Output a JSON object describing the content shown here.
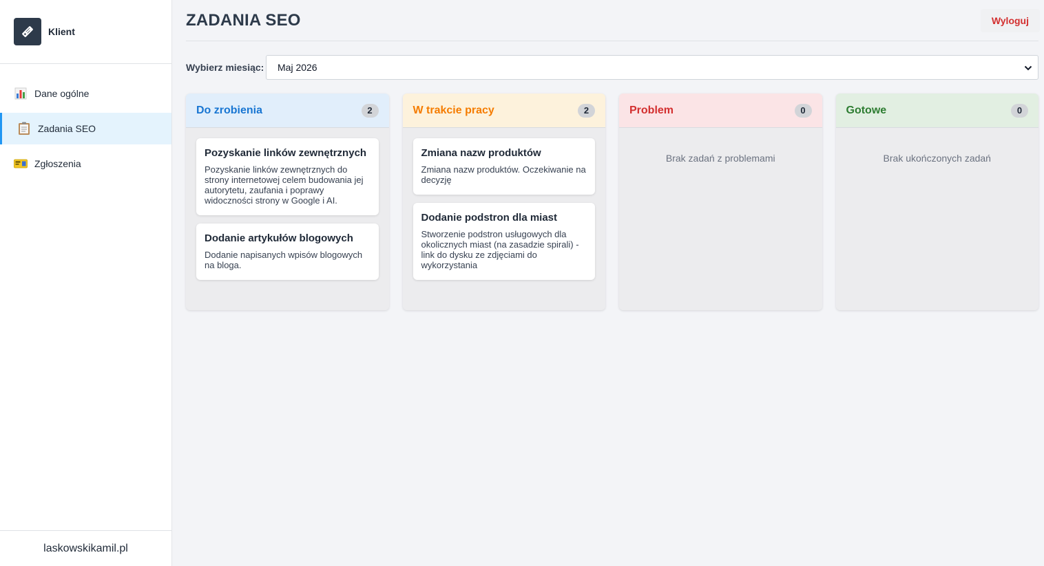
{
  "sidebar": {
    "brand_name": "Klient",
    "items": [
      {
        "label": "Dane ogólne",
        "icon": "bar-chart-icon"
      },
      {
        "label": "Zadania SEO",
        "icon": "clipboard-icon",
        "active": true
      },
      {
        "label": "Zgłoszenia",
        "icon": "ticket-icon"
      }
    ],
    "footer": "laskowskikamil.pl"
  },
  "header": {
    "title": "ZADANIA SEO",
    "logout_label": "Wyloguj"
  },
  "month": {
    "label": "Wybierz miesiąc:",
    "selected": "Maj 2026"
  },
  "columns": [
    {
      "title": "Do zrobienia",
      "count": "2",
      "color": "#1976d2",
      "bg": "#e1eefb",
      "cards": [
        {
          "title": "Pozyskanie linków zewnętrznych",
          "desc": "Pozyskanie linków zewnętrznych do strony internetowej celem budowania jej autorytetu, zaufania i poprawy widoczności strony w Google i AI."
        },
        {
          "title": "Dodanie artykułów blogowych",
          "desc": "Dodanie napisanych wpisów blogowych na bloga."
        }
      ]
    },
    {
      "title": "W trakcie pracy",
      "count": "2",
      "color": "#f57c00",
      "bg": "#fdf2dc",
      "cards": [
        {
          "title": "Zmiana nazw produktów",
          "desc": "Zmiana nazw produktów. Oczekiwanie na decyzję"
        },
        {
          "title": "Dodanie podstron dla miast",
          "desc": "Stworzenie podstron usługowych dla okolicznych miast (na zasadzie spirali) - link do dysku ze zdjęciami do wykorzystania"
        }
      ]
    },
    {
      "title": "Problem",
      "count": "0",
      "color": "#d32f2f",
      "bg": "#fbe4e6",
      "empty": "Brak zadań z problemami"
    },
    {
      "title": "Gotowe",
      "count": "0",
      "color": "#2e7d32",
      "bg": "#e2efe2",
      "empty": "Brak ukończonych zadań"
    }
  ]
}
